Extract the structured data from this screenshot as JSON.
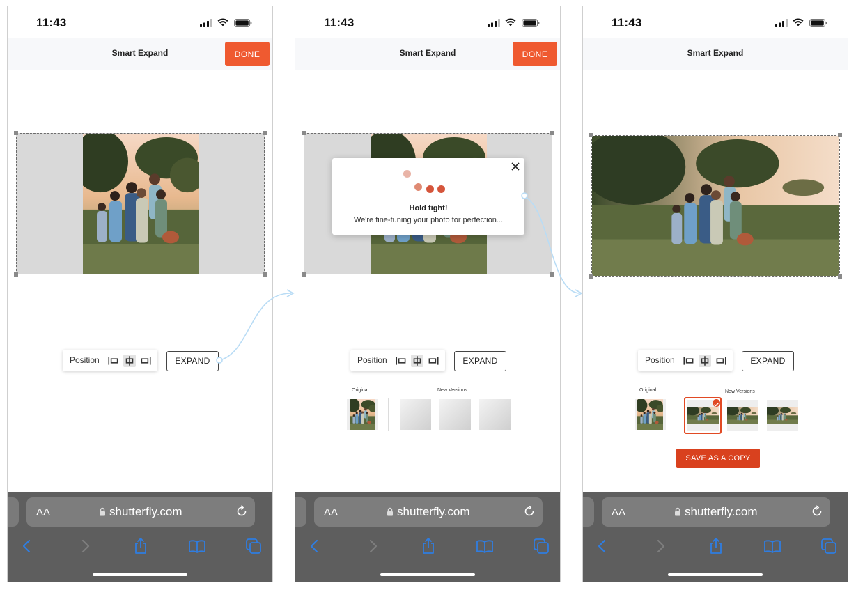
{
  "status_bar": {
    "time": "11:43"
  },
  "header": {
    "title": "Smart Expand",
    "done_label": "DONE"
  },
  "toolbar": {
    "position_label": "Position",
    "expand_label": "EXPAND"
  },
  "versions": {
    "original_label": "Original",
    "new_versions_label": "New Versions"
  },
  "loading_modal": {
    "title": "Hold tight!",
    "message": "We're fine-tuning your photo for perfection..."
  },
  "save_button": {
    "label": "SAVE AS A COPY"
  },
  "browser": {
    "text_size_label": "AA",
    "url": "shutterfly.com"
  },
  "colors": {
    "accent": "#ef5a30",
    "accent_dark": "#d9411e",
    "browser_bar": "#5e5e5e",
    "link_blue": "#2f7de1",
    "connector": "#b9dcf5",
    "loading_dot_light": "#e9b4a7",
    "loading_dot_mid": "#df8a73",
    "loading_dot_dark": "#d5553b"
  },
  "icons": [
    "signal-icon",
    "wifi-icon",
    "battery-icon",
    "align-left-icon",
    "align-center-icon",
    "align-right-icon",
    "close-icon",
    "checkmark-icon",
    "lock-icon",
    "reload-icon",
    "back-icon",
    "forward-icon",
    "share-icon",
    "bookmarks-icon",
    "tabs-icon"
  ],
  "position_selected": "center",
  "selected_version": 1
}
